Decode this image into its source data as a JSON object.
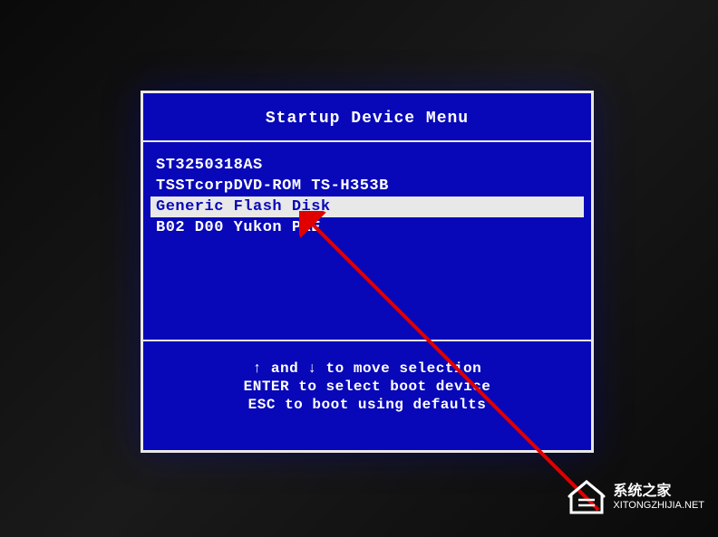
{
  "bios": {
    "title": "Startup Device Menu",
    "devices": [
      {
        "label": "ST3250318AS",
        "selected": false
      },
      {
        "label": "TSSTcorpDVD-ROM TS-H353B",
        "selected": false
      },
      {
        "label": "Generic Flash Disk",
        "selected": true
      },
      {
        "label": "B02 D00 Yukon PXE",
        "selected": false
      }
    ],
    "instructions": [
      "↑ and ↓ to move selection",
      "ENTER to select boot device",
      "ESC to boot using defaults"
    ]
  },
  "watermark": {
    "title": "系统之家",
    "url": "XITONGZHIJIA.NET"
  },
  "annotation": {
    "arrow_color": "#e00000"
  }
}
